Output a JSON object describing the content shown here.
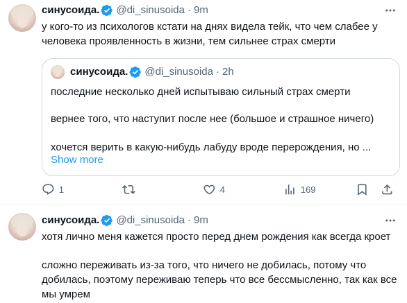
{
  "tweets": [
    {
      "author": {
        "name": "синусоида.",
        "handle": "@di_sinusoida",
        "time": "9m"
      },
      "text_lines": [
        "у кого-то из психологов кстати на днях видела тейк, что чем слабее у",
        "человека проявленность в жизни, тем сильнее страх смерти"
      ],
      "quote": {
        "author": {
          "name": "синусоида.",
          "handle": "@di_sinusoida",
          "time": "2h"
        },
        "text_lines": [
          "последние несколько дней испытываю сильный страх смерти",
          "вернее того, что наступит после нее (большое и страшное ничего)",
          "хочется верить в какую-нибудь лабуду вроде перерождения, но ..."
        ],
        "show_more": "Show more"
      },
      "actions": {
        "replies": "1",
        "retweets": "",
        "likes": "4",
        "views": "169"
      }
    },
    {
      "author": {
        "name": "синусоида.",
        "handle": "@di_sinusoida",
        "time": "9m"
      },
      "text_lines": [
        "хотя лично меня кажется просто перед днем рождения как всегда кроет",
        "сложно переживать из-за того, что ничего не добилась, потому что",
        "добилась, поэтому переживаю теперь что все бессмысленно, так как все",
        "мы умрем"
      ]
    }
  ],
  "separator": "·",
  "colors": {
    "accent": "#1d9bf0",
    "secondary": "#536471",
    "text": "#0f1419",
    "border": "#cfd9de"
  },
  "icons": [
    "verified-badge-icon",
    "more-icon",
    "reply-icon",
    "retweet-icon",
    "like-icon",
    "views-icon",
    "bookmark-icon",
    "share-icon"
  ]
}
